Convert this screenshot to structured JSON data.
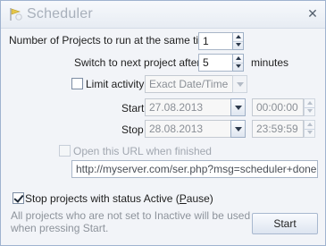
{
  "window": {
    "title": "Scheduler",
    "close_glyph": "✕",
    "icon": "scheduler-app-icon"
  },
  "projects": {
    "label": "Number of Projects to run at the same time",
    "value": "1"
  },
  "switch": {
    "label": "Switch to next project after",
    "value": "5",
    "unit": "minutes"
  },
  "limit": {
    "label": "Limit activity",
    "checked": false,
    "mode": "Exact Date/Time"
  },
  "start": {
    "label": "Start at",
    "date": "27.08.2013",
    "time": "00:00:00"
  },
  "stop": {
    "label": "Stop at",
    "date": "28.08.2013",
    "time": "23:59:59"
  },
  "open_url": {
    "label": "Open this URL when finished",
    "checked": false,
    "url": "http://myserver.com/ser.php?msg=scheduler+done"
  },
  "stop_projects": {
    "label_before": "Stop projects with status Active (",
    "label_underlined": "P",
    "label_after": "ause)",
    "checked": true
  },
  "note": {
    "line1": "All projects who are not set to Inactive will be used",
    "line2": "when pressing Start."
  },
  "buttons": {
    "start": "Start"
  }
}
